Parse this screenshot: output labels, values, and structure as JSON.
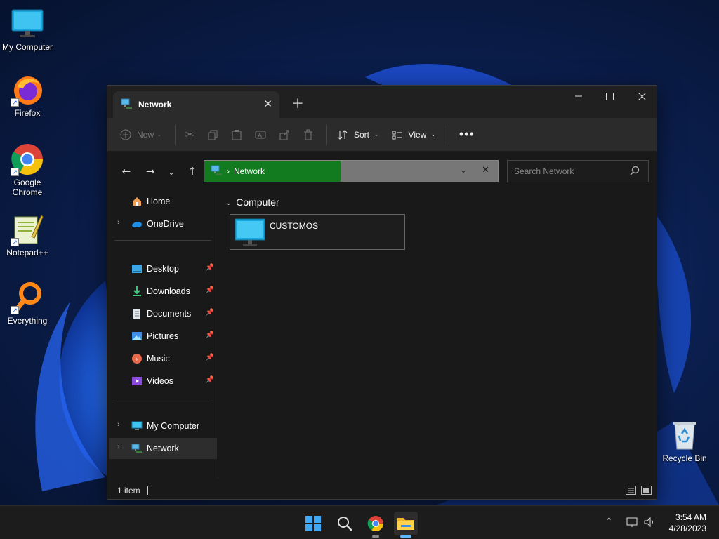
{
  "desktop": {
    "icons": [
      {
        "label": "My Computer"
      },
      {
        "label": "Firefox"
      },
      {
        "label": "Google Chrome"
      },
      {
        "label": "Notepad++"
      },
      {
        "label": "Everything"
      },
      {
        "label": "Recycle Bin"
      }
    ]
  },
  "window": {
    "tab_title": "Network",
    "toolbar": {
      "new_label": "New",
      "sort_label": "Sort",
      "view_label": "View"
    },
    "address": {
      "location": "Network",
      "separator": "›"
    },
    "search": {
      "placeholder": "Search Network"
    },
    "nav": {
      "items": [
        {
          "label": "Home"
        },
        {
          "label": "OneDrive"
        },
        {
          "label": "Desktop"
        },
        {
          "label": "Downloads"
        },
        {
          "label": "Documents"
        },
        {
          "label": "Pictures"
        },
        {
          "label": "Music"
        },
        {
          "label": "Videos"
        },
        {
          "label": "My Computer"
        },
        {
          "label": "Network"
        }
      ]
    },
    "content": {
      "group_title": "Computer",
      "items": [
        {
          "label": "CUSTOMOS"
        }
      ]
    },
    "status": {
      "item_count": "1 item"
    }
  },
  "taskbar": {
    "time": "3:54 AM",
    "date": "4/28/2023"
  },
  "colors": {
    "address_highlight": "#127a1f",
    "window_bg": "#191919",
    "toolbar_bg": "#2b2b2b"
  }
}
